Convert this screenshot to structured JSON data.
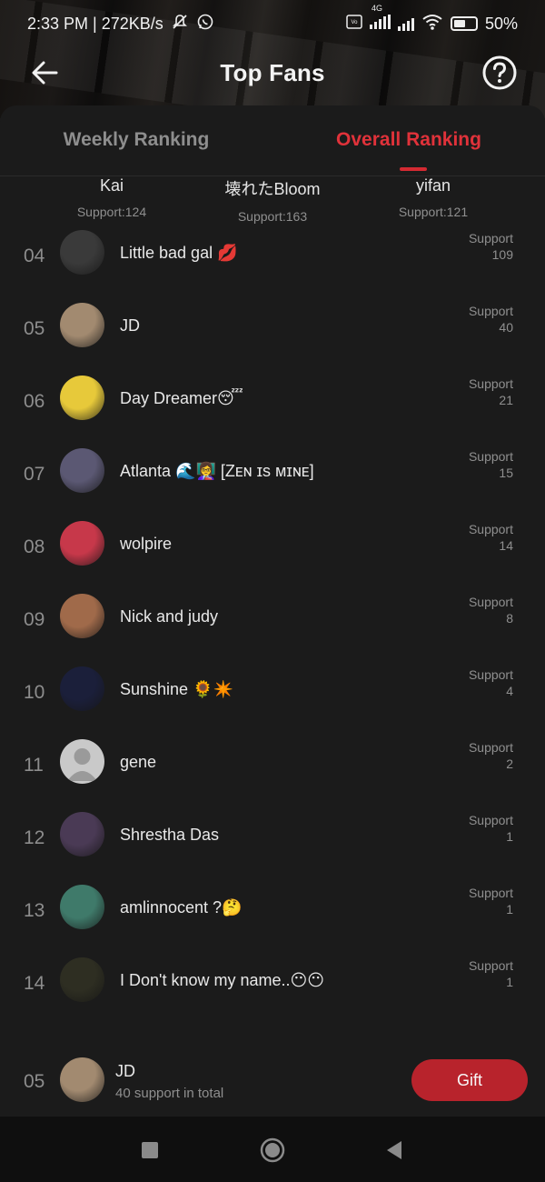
{
  "status_bar": {
    "time_speed": "2:33 PM | 272KB/s",
    "network_label": "4G",
    "battery": "50%"
  },
  "header": {
    "title": "Top Fans",
    "back_icon": "back-arrow-icon",
    "help_icon": "help-circle-icon"
  },
  "tabs": [
    {
      "label": "Weekly Ranking",
      "active": false
    },
    {
      "label": "Overall Ranking",
      "active": true
    }
  ],
  "top3": [
    {
      "name": "Kai",
      "support": "Support:124"
    },
    {
      "name": "壊れたBloom",
      "support": "Support:163"
    },
    {
      "name": "yifan",
      "support": "Support:121"
    }
  ],
  "support_label": "Support",
  "rankings": [
    {
      "rank": "04",
      "name": "Little bad gal 💋",
      "support": "109",
      "avatar_color": "#3a3a3a"
    },
    {
      "rank": "05",
      "name": "JD",
      "support": "40",
      "avatar_color": "#a28a70"
    },
    {
      "rank": "06",
      "name": "Day Dreamer😴",
      "support": "21",
      "avatar_color": "#e7c93a"
    },
    {
      "rank": "07",
      "name": "Atlanta 🌊👩‍🏫 [Zᴇɴ ɪs ᴍɪɴᴇ]",
      "support": "15",
      "avatar_color": "#5b5873"
    },
    {
      "rank": "08",
      "name": "wolpire",
      "support": "14",
      "avatar_color": "#c7384a"
    },
    {
      "rank": "09",
      "name": "Nick and judy",
      "support": "8",
      "avatar_color": "#a06a4a"
    },
    {
      "rank": "10",
      "name": "Sunshine 🌻✴️",
      "support": "4",
      "avatar_color": "#1b1f3a"
    },
    {
      "rank": "11",
      "name": "gene",
      "support": "2",
      "avatar_color": "#c9c9c9"
    },
    {
      "rank": "12",
      "name": "Shrestha Das",
      "support": "1",
      "avatar_color": "#4a3a55"
    },
    {
      "rank": "13",
      "name": "amlinnocent ?🤔",
      "support": "1",
      "avatar_color": "#3f7a6a"
    },
    {
      "rank": "14",
      "name": "I Don't know my name..😶😶",
      "support": "1",
      "avatar_color": "#2e2e22"
    }
  ],
  "my_rank": {
    "rank": "05",
    "name": "JD",
    "total": "40 support in total",
    "avatar_color": "#a28a70"
  },
  "gift_button": "Gift"
}
